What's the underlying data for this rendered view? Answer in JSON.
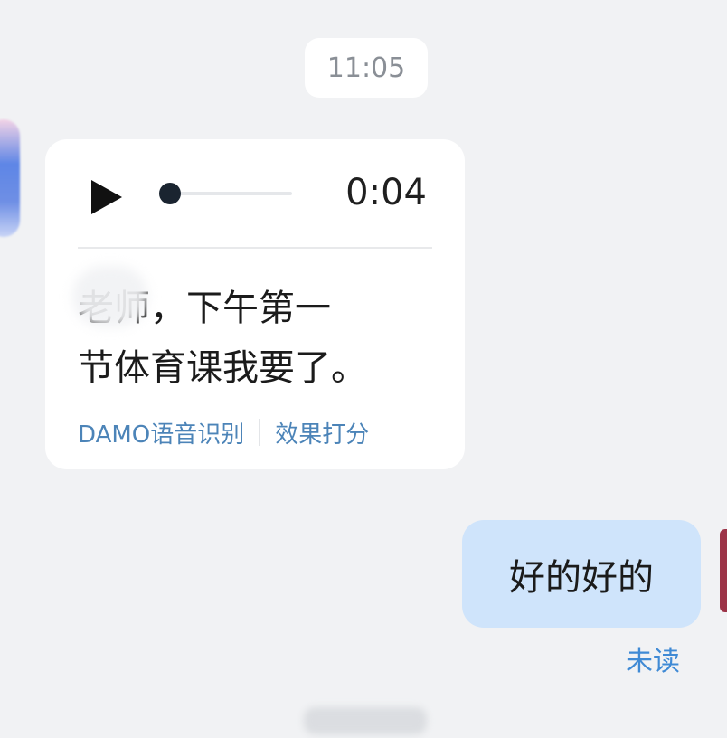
{
  "chat": {
    "timestamp": "11:05",
    "incoming_voice": {
      "duration": "0:04",
      "progress": 0.0,
      "transcript_line1": "老师，下午第一",
      "transcript_line2": "节体育课我要了。",
      "engine_label": "DAMO语音识别",
      "rate_label": "效果打分"
    },
    "outgoing": {
      "text": "好的好的",
      "status": "未读"
    }
  },
  "colors": {
    "background": "#f1f2f4",
    "bubble_in": "#ffffff",
    "bubble_out": "#cfe4fb",
    "link": "#4c84b8",
    "status": "#3f8ad5"
  },
  "icons": {
    "play": "play-icon"
  }
}
